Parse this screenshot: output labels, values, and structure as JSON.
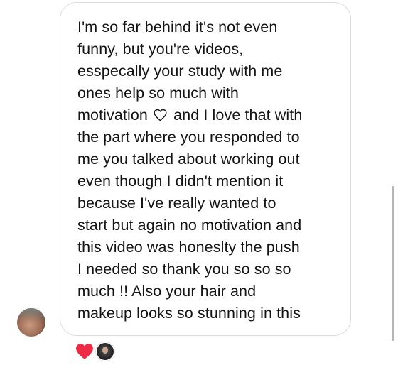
{
  "message": {
    "lines": [
      "I'm so far behind it's not even",
      "funny, but you're videos,",
      "esspecally your study with me",
      "ones help so much with",
      "motivation",
      "and I love that with",
      "the part where you responded to",
      "me you talked about working out",
      "even though I didn't mention it",
      "because I've really wanted to",
      "start but again no motivation and",
      "this video was honeslty the push",
      "I needed so thank you so so so",
      "much !! Also your hair and",
      "makeup looks so stunning in this"
    ]
  },
  "icons": {
    "inline_heart": "heart-outline-icon",
    "reaction": "heart-filled-icon"
  },
  "colors": {
    "text": "#141414",
    "bubble_border": "#dcdcdc",
    "reaction_heart": "#ee2a45"
  }
}
